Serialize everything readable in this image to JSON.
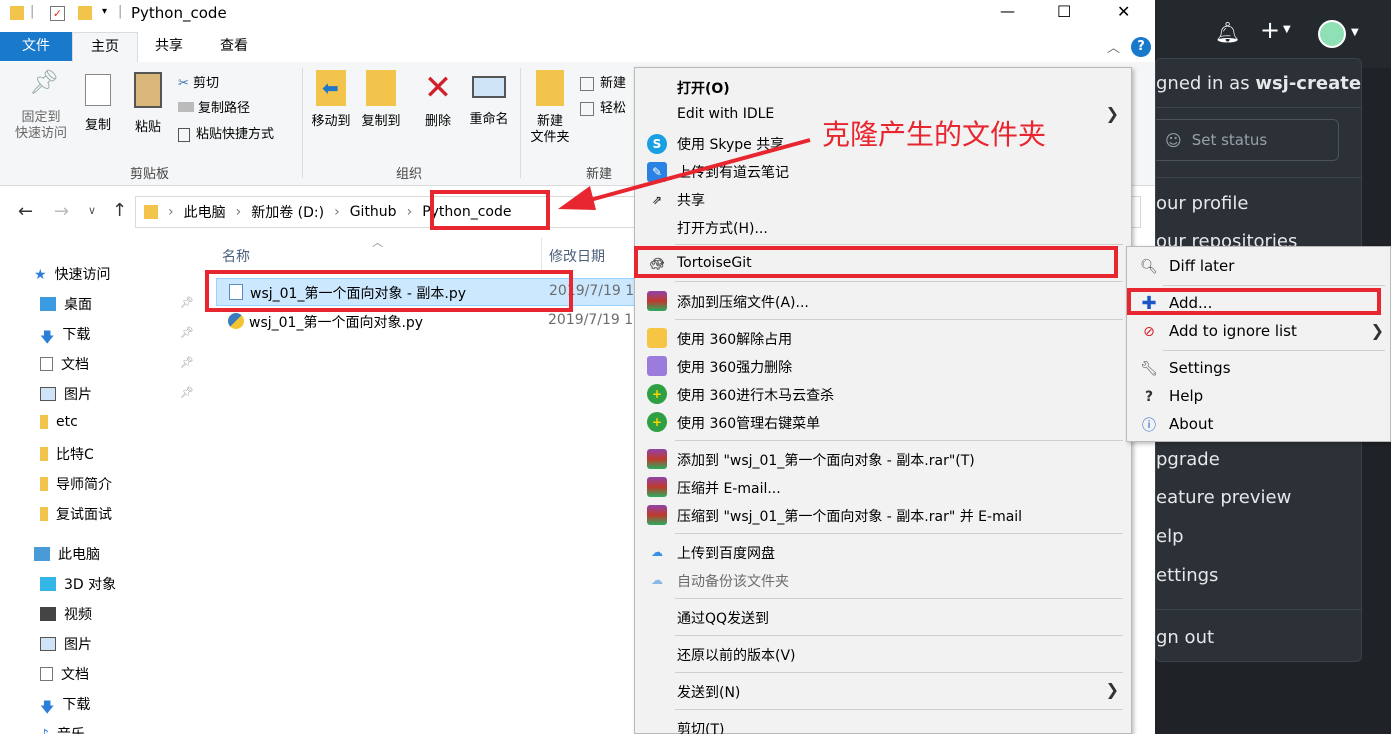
{
  "window": {
    "title": "Python_code",
    "min": "—",
    "max": "☐",
    "close": "✕",
    "help": "?"
  },
  "tabs": [
    "文件",
    "主页",
    "共享",
    "查看"
  ],
  "ribbon": {
    "pin": [
      "固定到",
      "快速访问"
    ],
    "copy": "复制",
    "paste": "粘贴",
    "cut": "剪切",
    "copy_path": "复制路径",
    "paste_shortcut": "粘贴快捷方式",
    "group_clipboard": "剪贴板",
    "move_to": "移动到",
    "copy_to": "复制到",
    "delete": "删除",
    "rename": "重命名",
    "group_organize": "组织",
    "new_folder": [
      "新建",
      "文件夹"
    ],
    "new_item": "新建",
    "easy_access": "轻松",
    "group_new": "新建"
  },
  "address": {
    "crumbs": [
      "此电脑",
      "新加卷 (D:)",
      "Github",
      "Python_code"
    ]
  },
  "nav": {
    "quick_access": "快速访问",
    "items": [
      "桌面",
      "下载",
      "文档",
      "图片",
      "etc",
      "比特C",
      "导师简介",
      "复试面试"
    ],
    "this_pc": "此电脑",
    "pc_items": [
      "3D 对象",
      "视频",
      "图片",
      "文档",
      "下载",
      "音乐"
    ]
  },
  "files": {
    "col_name": "名称",
    "col_date": "修改日期",
    "rows": [
      {
        "name": "wsj_01_第一个面向对象 - 副本.py",
        "date": "2019/7/19 1"
      },
      {
        "name": "wsj_01_第一个面向对象.py",
        "date": "2019/7/19 1"
      }
    ]
  },
  "annotation": {
    "text": "克隆产生的文件夹",
    "color": "#e8262f"
  },
  "context_menu": {
    "items": [
      "打开(O)",
      "Edit with IDLE",
      "使用 Skype 共享",
      "上传到有道云笔记",
      "共享",
      "打开方式(H)...",
      "TortoiseGit",
      "添加到压缩文件(A)...",
      "使用 360解除占用",
      "使用 360强力删除",
      "使用 360进行木马云查杀",
      "使用 360管理右键菜单",
      "添加到 \"wsj_01_第一个面向对象 - 副本.rar\"(T)",
      "压缩并 E-mail...",
      "压缩到 \"wsj_01_第一个面向对象 - 副本.rar\" 并 E-mail",
      "上传到百度网盘",
      "自动备份该文件夹",
      "通过QQ发送到",
      "还原以前的版本(V)",
      "发送到(N)",
      "剪切(T)"
    ]
  },
  "submenu": {
    "items": [
      "Diff later",
      "Add...",
      "Add to ignore list",
      "Settings",
      "Help",
      "About"
    ]
  },
  "github": {
    "signed_in_prefix": "gned in as ",
    "username": "wsj-create",
    "set_status": "Set status",
    "items": [
      "our profile",
      "our repositories",
      "pgrade",
      "eature preview",
      "elp",
      "ettings",
      "gn out"
    ]
  }
}
